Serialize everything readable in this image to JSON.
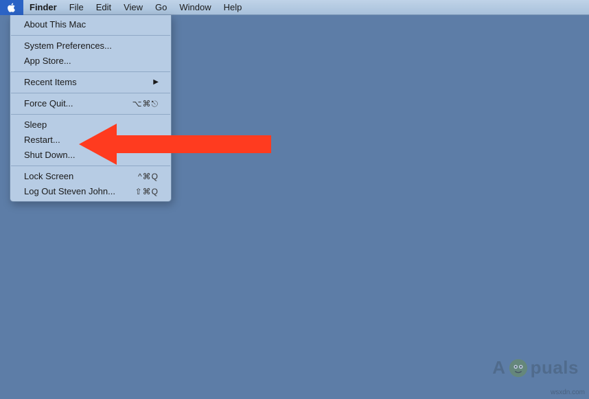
{
  "menubar": {
    "app": "Finder",
    "items": [
      "File",
      "Edit",
      "View",
      "Go",
      "Window",
      "Help"
    ]
  },
  "apple_menu": {
    "about": "About This Mac",
    "prefs": "System Preferences...",
    "appstore": "App Store...",
    "recent": "Recent Items",
    "forcequit": "Force Quit...",
    "forcequit_sc": "⌥⌘⎋",
    "sleep": "Sleep",
    "restart": "Restart...",
    "shutdown": "Shut Down...",
    "lock": "Lock Screen",
    "lock_sc": "^⌘Q",
    "logout": "Log Out Steven John...",
    "logout_sc": "⇧⌘Q"
  },
  "watermark": {
    "prefix": "A",
    "suffix": "puals",
    "url": "wsxdn.com"
  },
  "annotation": {
    "arrow_color": "#ff3b1f",
    "points_to": "restart-menu-item"
  }
}
